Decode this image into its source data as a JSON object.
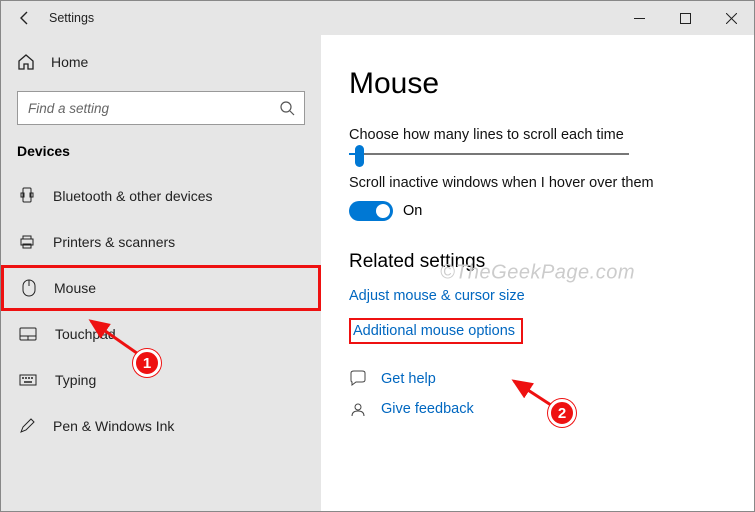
{
  "window": {
    "title": "Settings"
  },
  "sidebar": {
    "home": "Home",
    "search_placeholder": "Find a setting",
    "group": "Devices",
    "items": [
      {
        "label": "Bluetooth & other devices"
      },
      {
        "label": "Printers & scanners"
      },
      {
        "label": "Mouse"
      },
      {
        "label": "Touchpad"
      },
      {
        "label": "Typing"
      },
      {
        "label": "Pen & Windows Ink"
      }
    ]
  },
  "page": {
    "title": "Mouse",
    "scroll_lines_label": "Choose how many lines to scroll each time",
    "scroll_inactive_label": "Scroll inactive windows when I hover over them",
    "toggle_on_text": "On",
    "related_heading": "Related settings",
    "link_adjust": "Adjust mouse & cursor size",
    "link_additional": "Additional mouse options",
    "get_help": "Get help",
    "give_feedback": "Give feedback"
  },
  "watermark": "©TheGeekPage.com",
  "annotations": {
    "badge1": "1",
    "badge2": "2"
  }
}
